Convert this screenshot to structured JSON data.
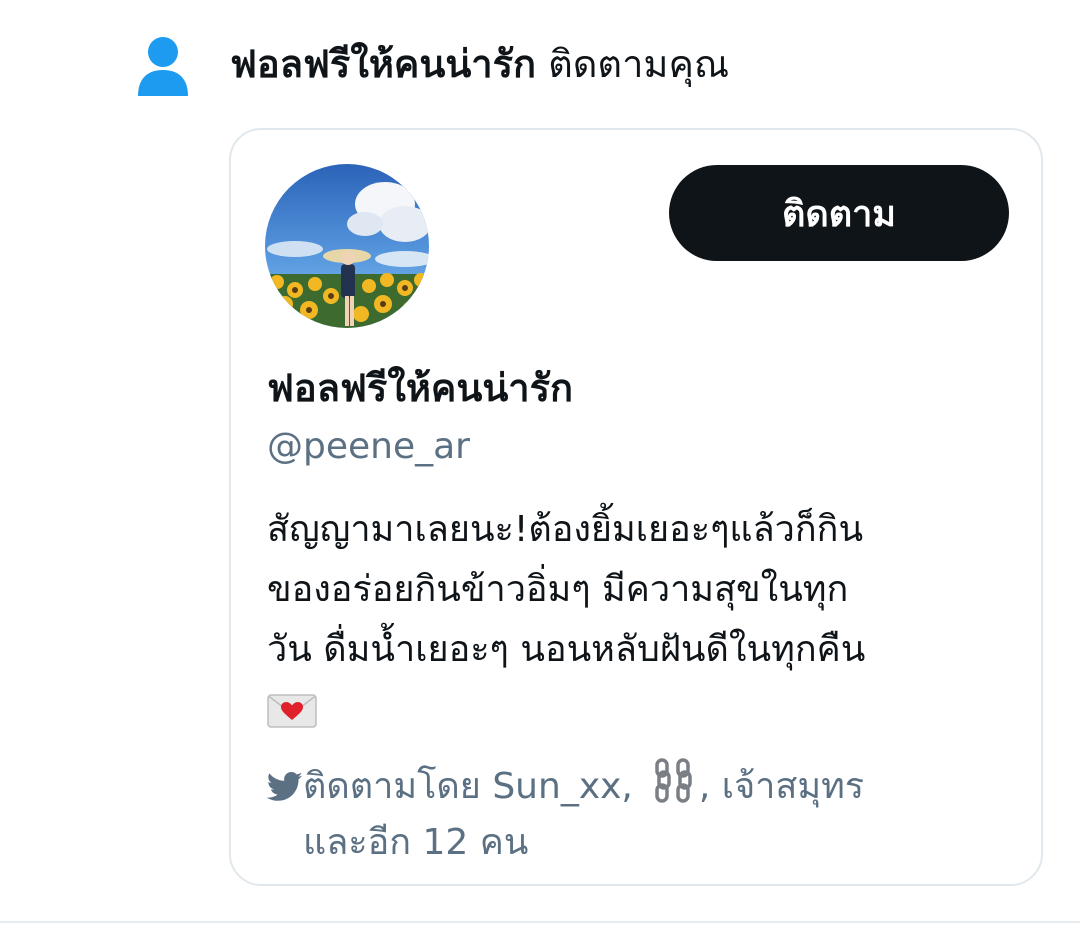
{
  "notification": {
    "actor_name": "ฟอลฟรีให้คนน่ารัก",
    "action_text": "ติดตามคุณ",
    "icon": "person-icon",
    "accent_color": "#1d9bf0"
  },
  "card": {
    "follow_label": "ติดตาม",
    "display_name": "ฟอลฟรีให้คนน่ารัก",
    "handle": "@peene_ar",
    "bio_lines": [
      "สัญญามาเลยนะ!ต้องยิ้มเยอะๆแล้วก็กิน",
      "ของอร่อยกินข้าวอิ่มๆ มีความสุขในทุก",
      "วัน ดื่มน้ำเยอะๆ นอนหลับฝันดีในทุกคืน"
    ],
    "bio_emoji": "love-letter-icon",
    "followed_by": {
      "icon": "bird-icon",
      "prefix": "ติดตามโดย Sun_xx,",
      "chain_icon": "chain-icon",
      "second": ", เจ้าสมุทร",
      "more": "และอีก 12 คน"
    }
  }
}
